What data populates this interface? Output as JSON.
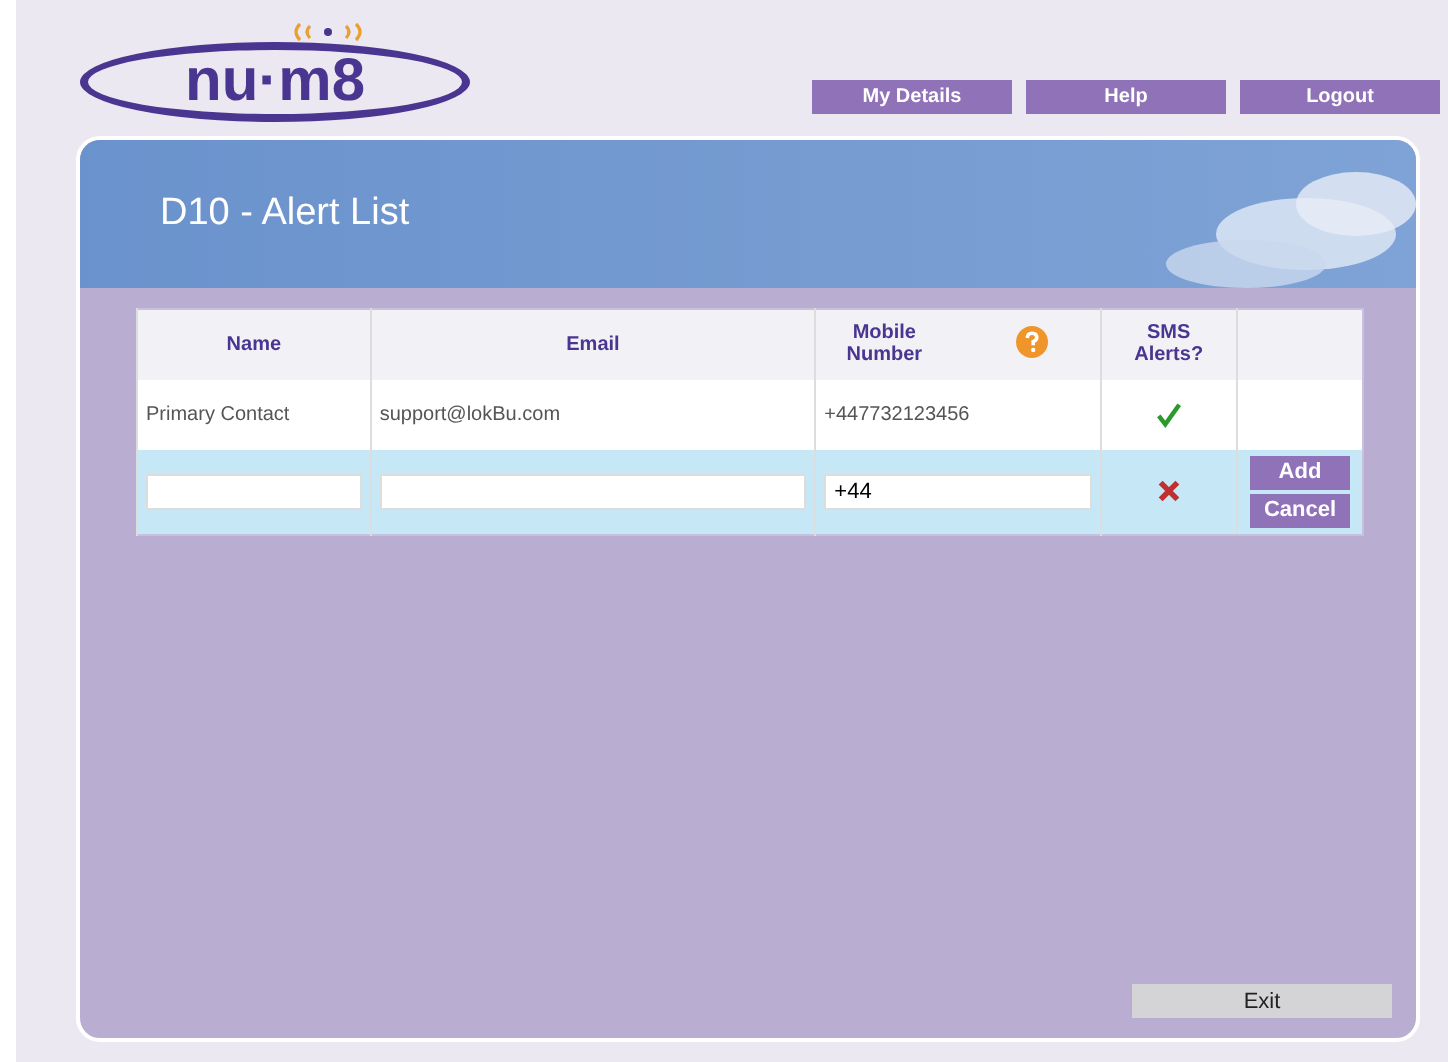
{
  "logo": {
    "text": "nu·m8"
  },
  "nav": [
    "My Details",
    "Help",
    "Logout"
  ],
  "page_title": "D10 - Alert List",
  "table": {
    "columns": [
      "Name",
      "Email",
      "Mobile Number",
      "SMS Alerts?"
    ],
    "rows": [
      {
        "name": "Primary Contact",
        "email": "support@lokBu.com",
        "mobile": "+447732123456",
        "sms_alerts": true
      }
    ],
    "new_row": {
      "mobile": "+44",
      "sms_alerts": false,
      "buttons": [
        "Add",
        "Cancel"
      ]
    }
  },
  "exit_button": "Exit"
}
